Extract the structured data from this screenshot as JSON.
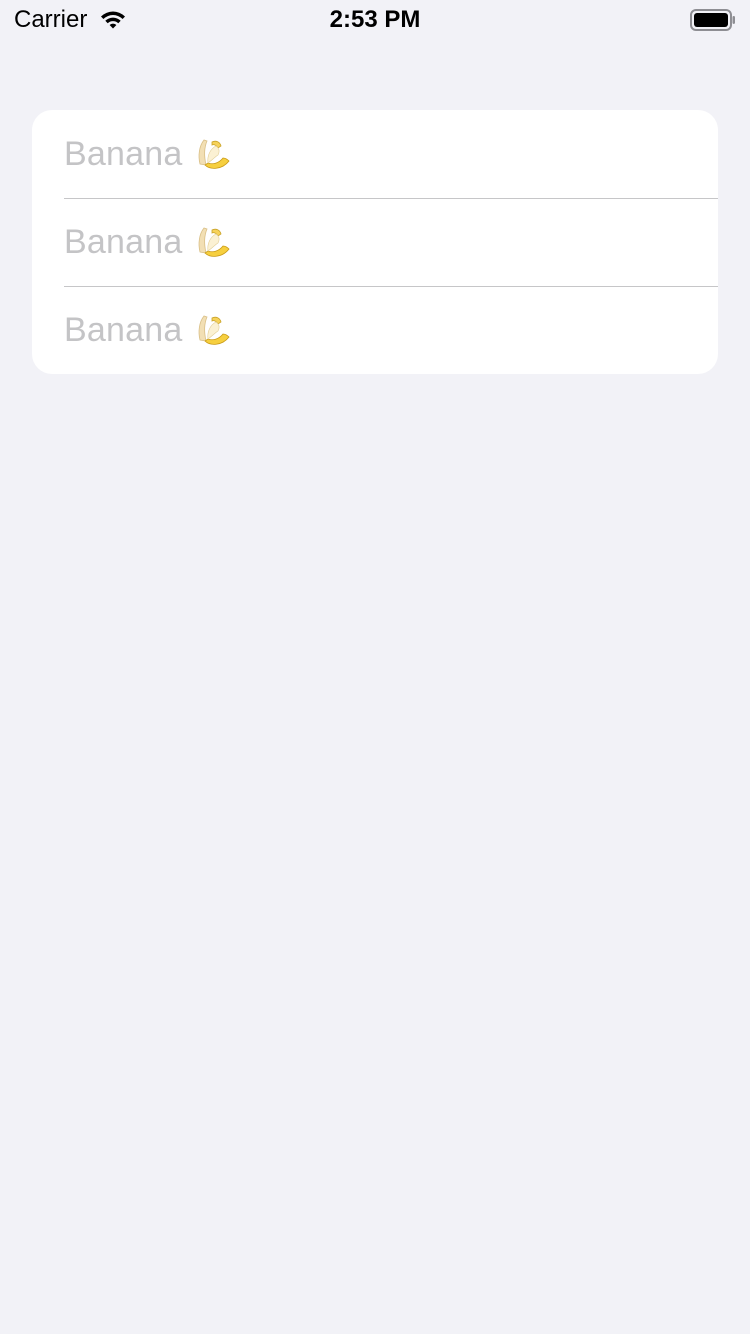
{
  "status_bar": {
    "carrier": "Carrier",
    "time": "2:53 PM",
    "wifi_icon": "wifi-icon",
    "battery_icon": "battery-icon"
  },
  "list": {
    "items": [
      {
        "label": "Banana",
        "icon": "banana-icon"
      },
      {
        "label": "Banana",
        "icon": "banana-icon"
      },
      {
        "label": "Banana",
        "icon": "banana-icon"
      }
    ]
  },
  "colors": {
    "background": "#f2f2f7",
    "card": "#ffffff",
    "placeholder_text": "#c4c4c6",
    "separator": "#c6c6c8"
  }
}
